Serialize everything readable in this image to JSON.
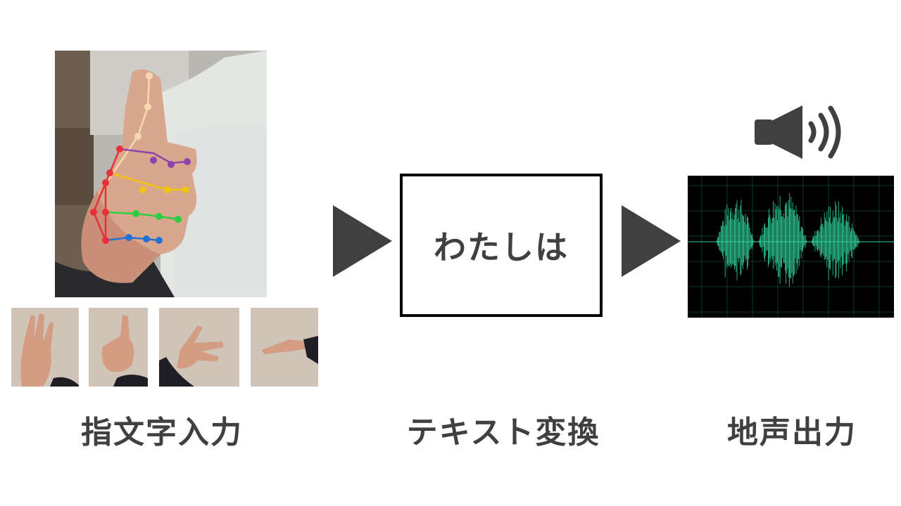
{
  "diagram": {
    "steps": [
      {
        "caption": "指文字入力"
      },
      {
        "caption": "テキスト変換",
        "box_text": "わたしは"
      },
      {
        "caption": "地声出力"
      }
    ]
  },
  "colors": {
    "arrow": "#404040",
    "caption": "#404040",
    "waveform_line": "#2fd39a",
    "waveform_background": "#000000",
    "landmark_thumb": "#f5d9b0",
    "landmark_index": "#8e44ad",
    "landmark_middle": "#f1c40f",
    "landmark_ring": "#2ecc40",
    "landmark_pinky": "#2471d6",
    "landmark_palm": "#e8303a"
  },
  "icons": {
    "speaker": "speaker-icon",
    "arrows": "triangle-right-icon"
  }
}
